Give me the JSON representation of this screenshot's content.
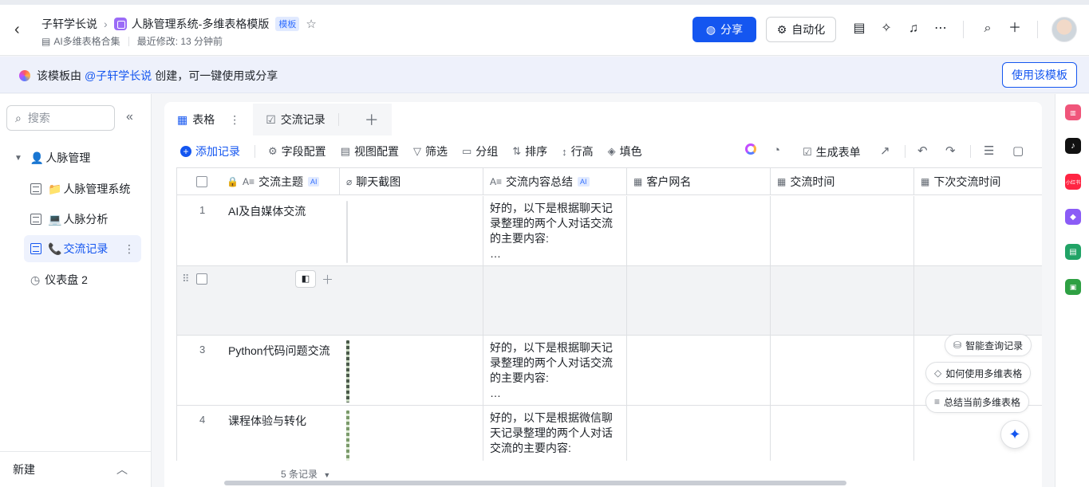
{
  "header": {
    "workspace": "子轩学长说",
    "doc_title": "人脉管理系统-多维表格模版",
    "badge": "模板",
    "collection": "AI多维表格合集",
    "last_modified": "最近修改: 13 分钟前",
    "share_label": "分享",
    "automation_label": "自动化"
  },
  "banner": {
    "prefix": "该模板由",
    "author": "@子轩学长说",
    "suffix": "创建，可一键使用或分享",
    "use_label": "使用该模板"
  },
  "sidebar": {
    "search_placeholder": "搜索",
    "root": "人脉管理",
    "items": [
      {
        "emoji": "📁",
        "label": "人脉管理系统"
      },
      {
        "emoji": "💻",
        "label": "人脉分析"
      },
      {
        "emoji": "📞",
        "label": "交流记录"
      },
      {
        "emoji": "",
        "label": "仪表盘 2"
      }
    ],
    "new_label": "新建"
  },
  "tabs": [
    {
      "label": "表格"
    },
    {
      "label": "交流记录"
    }
  ],
  "toolbar": {
    "add_record": "添加记录",
    "field_config": "字段配置",
    "view_config": "视图配置",
    "filter": "筛选",
    "group": "分组",
    "sort": "排序",
    "row_height": "行高",
    "fill": "填色",
    "gen_form": "生成表单"
  },
  "columns": [
    "交流主题",
    "聊天截图",
    "交流内容总结",
    "客户网名",
    "交流时间",
    "下次交流时间"
  ],
  "column_ai": "AI",
  "rows": [
    {
      "num": "1",
      "topic": "AI及自媒体交流",
      "summary": "好的，以下是根据聊天记录整理的两个人对话交流的主要内容:",
      "more": "…"
    },
    {
      "num": "3",
      "topic": "Python代码问题交流",
      "summary": "好的，以下是根据聊天记录整理的两个人对话交流的主要内容:",
      "more": "…"
    },
    {
      "num": "4",
      "topic": "课程体验与转化",
      "summary": "好的，以下是根据微信聊天记录整理的两个人对话交流的主要内容:",
      "more": ""
    }
  ],
  "footer": {
    "count": "5 条记录"
  },
  "assistant": {
    "query": "智能查询记录",
    "howto": "如何使用多维表格",
    "summarize": "总结当前多维表格"
  },
  "colors": {
    "accent": "#1456f0",
    "active_bg": "#eef2fd"
  }
}
